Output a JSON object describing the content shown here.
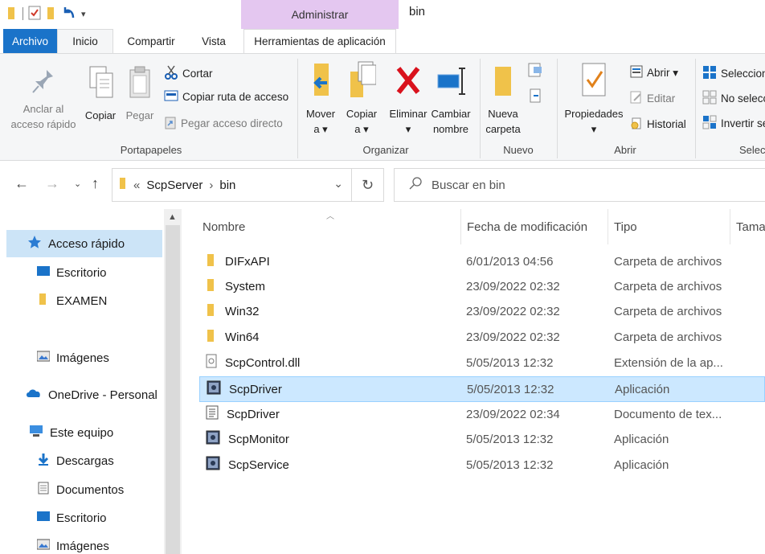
{
  "window": {
    "title": "bin",
    "context_group": "Administrar"
  },
  "tabs": [
    "Archivo",
    "Inicio",
    "Compartir",
    "Vista",
    "Herramientas de aplicación"
  ],
  "ribbon": {
    "portapapeles": {
      "label": "Portapapeles",
      "pin": "Anclar al\nacceso rápido",
      "copy": "Copiar",
      "paste": "Pegar",
      "cut": "Cortar",
      "copy_path": "Copiar ruta de acceso",
      "paste_shortcut": "Pegar acceso directo"
    },
    "organizar": {
      "label": "Organizar",
      "move": "Mover\na ▾",
      "copy_to": "Copiar\na ▾",
      "delete": "Eliminar\n▾",
      "rename": "Cambiar\nnombre"
    },
    "nuevo": {
      "label": "Nuevo",
      "new_folder": "Nueva\ncarpeta"
    },
    "abrir": {
      "label": "Abrir",
      "properties": "Propiedades\n▾",
      "open": "Abrir ▾",
      "edit": "Editar",
      "history": "Historial"
    },
    "seleccionar": {
      "label": "Selec",
      "select_all": "Seleccion",
      "select_none": "No selecc",
      "invert": "Invertir se"
    }
  },
  "address": {
    "overflow": "«",
    "crumbs": [
      "ScpServer",
      "bin"
    ],
    "sep": "›"
  },
  "search": {
    "placeholder": "Buscar en bin"
  },
  "nav": [
    {
      "label": "Acceso rápido",
      "icon": "star-icon"
    },
    {
      "label": "Escritorio",
      "icon": "desktop-icon"
    },
    {
      "label": "EXAMEN",
      "icon": "folder-icon"
    },
    {
      "label": "Imágenes",
      "icon": "pictures-icon"
    },
    {
      "label": "OneDrive - Personal",
      "icon": "cloud-icon"
    },
    {
      "label": "Este equipo",
      "icon": "computer-icon"
    },
    {
      "label": "Descargas",
      "icon": "download-icon"
    },
    {
      "label": "Documentos",
      "icon": "documents-icon"
    },
    {
      "label": "Escritorio",
      "icon": "desktop-icon"
    },
    {
      "label": "Imágenes",
      "icon": "pictures-icon"
    }
  ],
  "columns": {
    "name": "Nombre",
    "date": "Fecha de modificación",
    "type": "Tipo",
    "size": "Tama"
  },
  "files": [
    {
      "name": "DIFxAPI",
      "date": "6/01/2013 04:56",
      "type": "Carpeta de archivos",
      "icon": "folder-icon"
    },
    {
      "name": "System",
      "date": "23/09/2022 02:32",
      "type": "Carpeta de archivos",
      "icon": "folder-icon"
    },
    {
      "name": "Win32",
      "date": "23/09/2022 02:32",
      "type": "Carpeta de archivos",
      "icon": "folder-icon"
    },
    {
      "name": "Win64",
      "date": "23/09/2022 02:32",
      "type": "Carpeta de archivos",
      "icon": "folder-icon"
    },
    {
      "name": "ScpControl.dll",
      "date": "5/05/2013 12:32",
      "type": "Extensión de la ap...",
      "icon": "dll-icon"
    },
    {
      "name": "ScpDriver",
      "date": "5/05/2013 12:32",
      "type": "Aplicación",
      "icon": "app-icon"
    },
    {
      "name": "ScpDriver",
      "date": "23/09/2022 02:34",
      "type": "Documento de tex...",
      "icon": "text-file-icon"
    },
    {
      "name": "ScpMonitor",
      "date": "5/05/2013 12:32",
      "type": "Aplicación",
      "icon": "app-icon"
    },
    {
      "name": "ScpService",
      "date": "5/05/2013 12:32",
      "type": "Aplicación",
      "icon": "app-icon"
    }
  ],
  "colors": {
    "accent": "#1a73c9",
    "context_tab": "#e4c7f0",
    "selection": "#cce8ff",
    "folder": "#f0c24a"
  }
}
